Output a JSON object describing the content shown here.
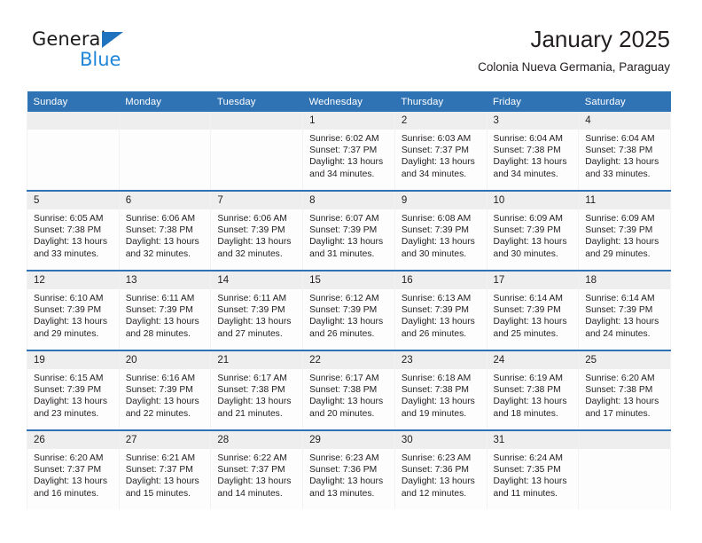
{
  "brand": {
    "name_part1": "General",
    "name_part2": "Blue",
    "triangle_color": "#1f72bd",
    "blue_text_color": "#1f86d8"
  },
  "header": {
    "title": "January 2025",
    "subtitle": "Colonia Nueva Germania, Paraguay",
    "accent_color": "#3073b4",
    "daynum_band_color": "#eeeeee"
  },
  "columns": [
    "Sunday",
    "Monday",
    "Tuesday",
    "Wednesday",
    "Thursday",
    "Friday",
    "Saturday"
  ],
  "weeks": [
    [
      {
        "day": "",
        "empty": true
      },
      {
        "day": "",
        "empty": true
      },
      {
        "day": "",
        "empty": true
      },
      {
        "day": "1",
        "sunrise": "Sunrise: 6:02 AM",
        "sunset": "Sunset: 7:37 PM",
        "daylight": "Daylight: 13 hours and 34 minutes."
      },
      {
        "day": "2",
        "sunrise": "Sunrise: 6:03 AM",
        "sunset": "Sunset: 7:37 PM",
        "daylight": "Daylight: 13 hours and 34 minutes."
      },
      {
        "day": "3",
        "sunrise": "Sunrise: 6:04 AM",
        "sunset": "Sunset: 7:38 PM",
        "daylight": "Daylight: 13 hours and 34 minutes."
      },
      {
        "day": "4",
        "sunrise": "Sunrise: 6:04 AM",
        "sunset": "Sunset: 7:38 PM",
        "daylight": "Daylight: 13 hours and 33 minutes."
      }
    ],
    [
      {
        "day": "5",
        "sunrise": "Sunrise: 6:05 AM",
        "sunset": "Sunset: 7:38 PM",
        "daylight": "Daylight: 13 hours and 33 minutes."
      },
      {
        "day": "6",
        "sunrise": "Sunrise: 6:06 AM",
        "sunset": "Sunset: 7:38 PM",
        "daylight": "Daylight: 13 hours and 32 minutes."
      },
      {
        "day": "7",
        "sunrise": "Sunrise: 6:06 AM",
        "sunset": "Sunset: 7:39 PM",
        "daylight": "Daylight: 13 hours and 32 minutes."
      },
      {
        "day": "8",
        "sunrise": "Sunrise: 6:07 AM",
        "sunset": "Sunset: 7:39 PM",
        "daylight": "Daylight: 13 hours and 31 minutes."
      },
      {
        "day": "9",
        "sunrise": "Sunrise: 6:08 AM",
        "sunset": "Sunset: 7:39 PM",
        "daylight": "Daylight: 13 hours and 30 minutes."
      },
      {
        "day": "10",
        "sunrise": "Sunrise: 6:09 AM",
        "sunset": "Sunset: 7:39 PM",
        "daylight": "Daylight: 13 hours and 30 minutes."
      },
      {
        "day": "11",
        "sunrise": "Sunrise: 6:09 AM",
        "sunset": "Sunset: 7:39 PM",
        "daylight": "Daylight: 13 hours and 29 minutes."
      }
    ],
    [
      {
        "day": "12",
        "sunrise": "Sunrise: 6:10 AM",
        "sunset": "Sunset: 7:39 PM",
        "daylight": "Daylight: 13 hours and 29 minutes."
      },
      {
        "day": "13",
        "sunrise": "Sunrise: 6:11 AM",
        "sunset": "Sunset: 7:39 PM",
        "daylight": "Daylight: 13 hours and 28 minutes."
      },
      {
        "day": "14",
        "sunrise": "Sunrise: 6:11 AM",
        "sunset": "Sunset: 7:39 PM",
        "daylight": "Daylight: 13 hours and 27 minutes."
      },
      {
        "day": "15",
        "sunrise": "Sunrise: 6:12 AM",
        "sunset": "Sunset: 7:39 PM",
        "daylight": "Daylight: 13 hours and 26 minutes."
      },
      {
        "day": "16",
        "sunrise": "Sunrise: 6:13 AM",
        "sunset": "Sunset: 7:39 PM",
        "daylight": "Daylight: 13 hours and 26 minutes."
      },
      {
        "day": "17",
        "sunrise": "Sunrise: 6:14 AM",
        "sunset": "Sunset: 7:39 PM",
        "daylight": "Daylight: 13 hours and 25 minutes."
      },
      {
        "day": "18",
        "sunrise": "Sunrise: 6:14 AM",
        "sunset": "Sunset: 7:39 PM",
        "daylight": "Daylight: 13 hours and 24 minutes."
      }
    ],
    [
      {
        "day": "19",
        "sunrise": "Sunrise: 6:15 AM",
        "sunset": "Sunset: 7:39 PM",
        "daylight": "Daylight: 13 hours and 23 minutes."
      },
      {
        "day": "20",
        "sunrise": "Sunrise: 6:16 AM",
        "sunset": "Sunset: 7:39 PM",
        "daylight": "Daylight: 13 hours and 22 minutes."
      },
      {
        "day": "21",
        "sunrise": "Sunrise: 6:17 AM",
        "sunset": "Sunset: 7:38 PM",
        "daylight": "Daylight: 13 hours and 21 minutes."
      },
      {
        "day": "22",
        "sunrise": "Sunrise: 6:17 AM",
        "sunset": "Sunset: 7:38 PM",
        "daylight": "Daylight: 13 hours and 20 minutes."
      },
      {
        "day": "23",
        "sunrise": "Sunrise: 6:18 AM",
        "sunset": "Sunset: 7:38 PM",
        "daylight": "Daylight: 13 hours and 19 minutes."
      },
      {
        "day": "24",
        "sunrise": "Sunrise: 6:19 AM",
        "sunset": "Sunset: 7:38 PM",
        "daylight": "Daylight: 13 hours and 18 minutes."
      },
      {
        "day": "25",
        "sunrise": "Sunrise: 6:20 AM",
        "sunset": "Sunset: 7:38 PM",
        "daylight": "Daylight: 13 hours and 17 minutes."
      }
    ],
    [
      {
        "day": "26",
        "sunrise": "Sunrise: 6:20 AM",
        "sunset": "Sunset: 7:37 PM",
        "daylight": "Daylight: 13 hours and 16 minutes."
      },
      {
        "day": "27",
        "sunrise": "Sunrise: 6:21 AM",
        "sunset": "Sunset: 7:37 PM",
        "daylight": "Daylight: 13 hours and 15 minutes."
      },
      {
        "day": "28",
        "sunrise": "Sunrise: 6:22 AM",
        "sunset": "Sunset: 7:37 PM",
        "daylight": "Daylight: 13 hours and 14 minutes."
      },
      {
        "day": "29",
        "sunrise": "Sunrise: 6:23 AM",
        "sunset": "Sunset: 7:36 PM",
        "daylight": "Daylight: 13 hours and 13 minutes."
      },
      {
        "day": "30",
        "sunrise": "Sunrise: 6:23 AM",
        "sunset": "Sunset: 7:36 PM",
        "daylight": "Daylight: 13 hours and 12 minutes."
      },
      {
        "day": "31",
        "sunrise": "Sunrise: 6:24 AM",
        "sunset": "Sunset: 7:35 PM",
        "daylight": "Daylight: 13 hours and 11 minutes."
      },
      {
        "day": "",
        "empty": true
      }
    ]
  ]
}
